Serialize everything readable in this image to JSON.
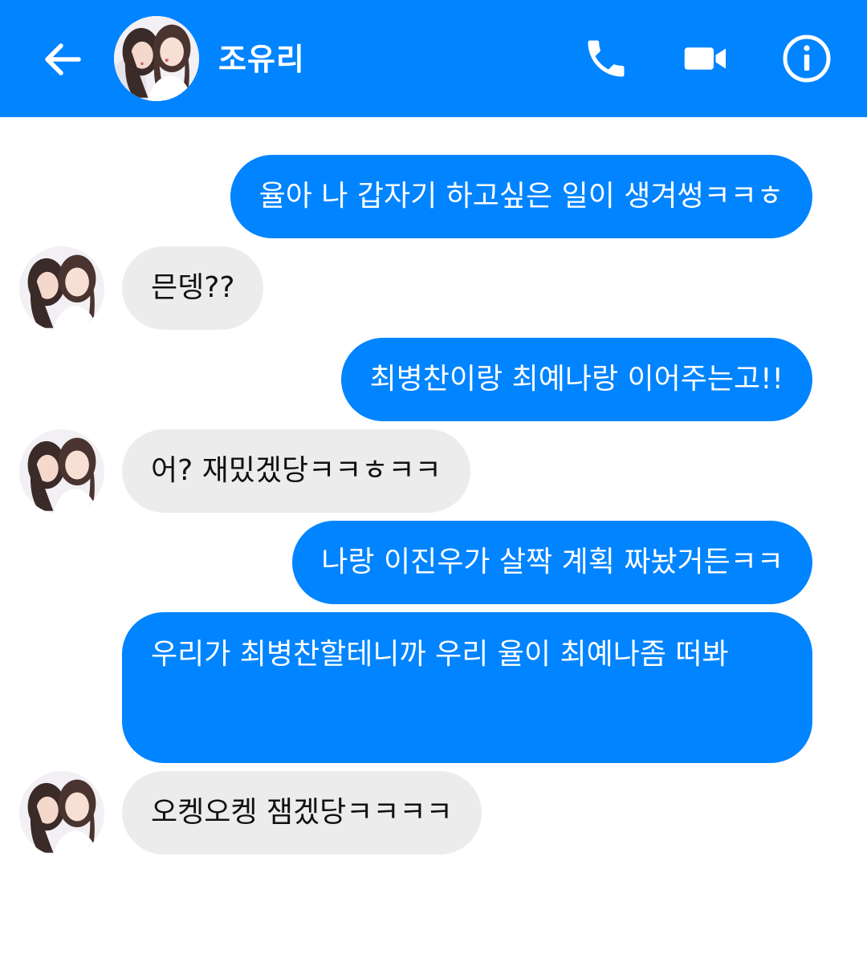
{
  "header": {
    "contact_name": "조유리",
    "back_icon": "back-arrow-icon",
    "call_icon": "phone-icon",
    "video_icon": "video-camera-icon",
    "info_icon": "info-icon",
    "background_color": "#0084ff"
  },
  "messages": [
    {
      "direction": "sent",
      "text": "율아 나 갑자기 하고싶은 일이 생겨썽ㅋㅋㅎ"
    },
    {
      "direction": "received",
      "text": "믄뎅??"
    },
    {
      "direction": "sent",
      "text": "최병찬이랑 최예나랑 이어주는고!!"
    },
    {
      "direction": "received",
      "text": "어? 재밌겠당ㅋㅋㅎㅋㅋ"
    },
    {
      "direction": "sent",
      "text": "나랑 이진우가 살짝 계획 짜놨거든ㅋㅋ"
    },
    {
      "direction": "sent",
      "text": "우리가 최병찬할테니까 우리 율이 최예나좀 떠봐"
    },
    {
      "direction": "received",
      "text": "오켕오켕 잼겠당ㅋㅋㅋㅋ"
    }
  ],
  "colors": {
    "sent_bubble": "#0084ff",
    "received_bubble": "#ececec"
  }
}
